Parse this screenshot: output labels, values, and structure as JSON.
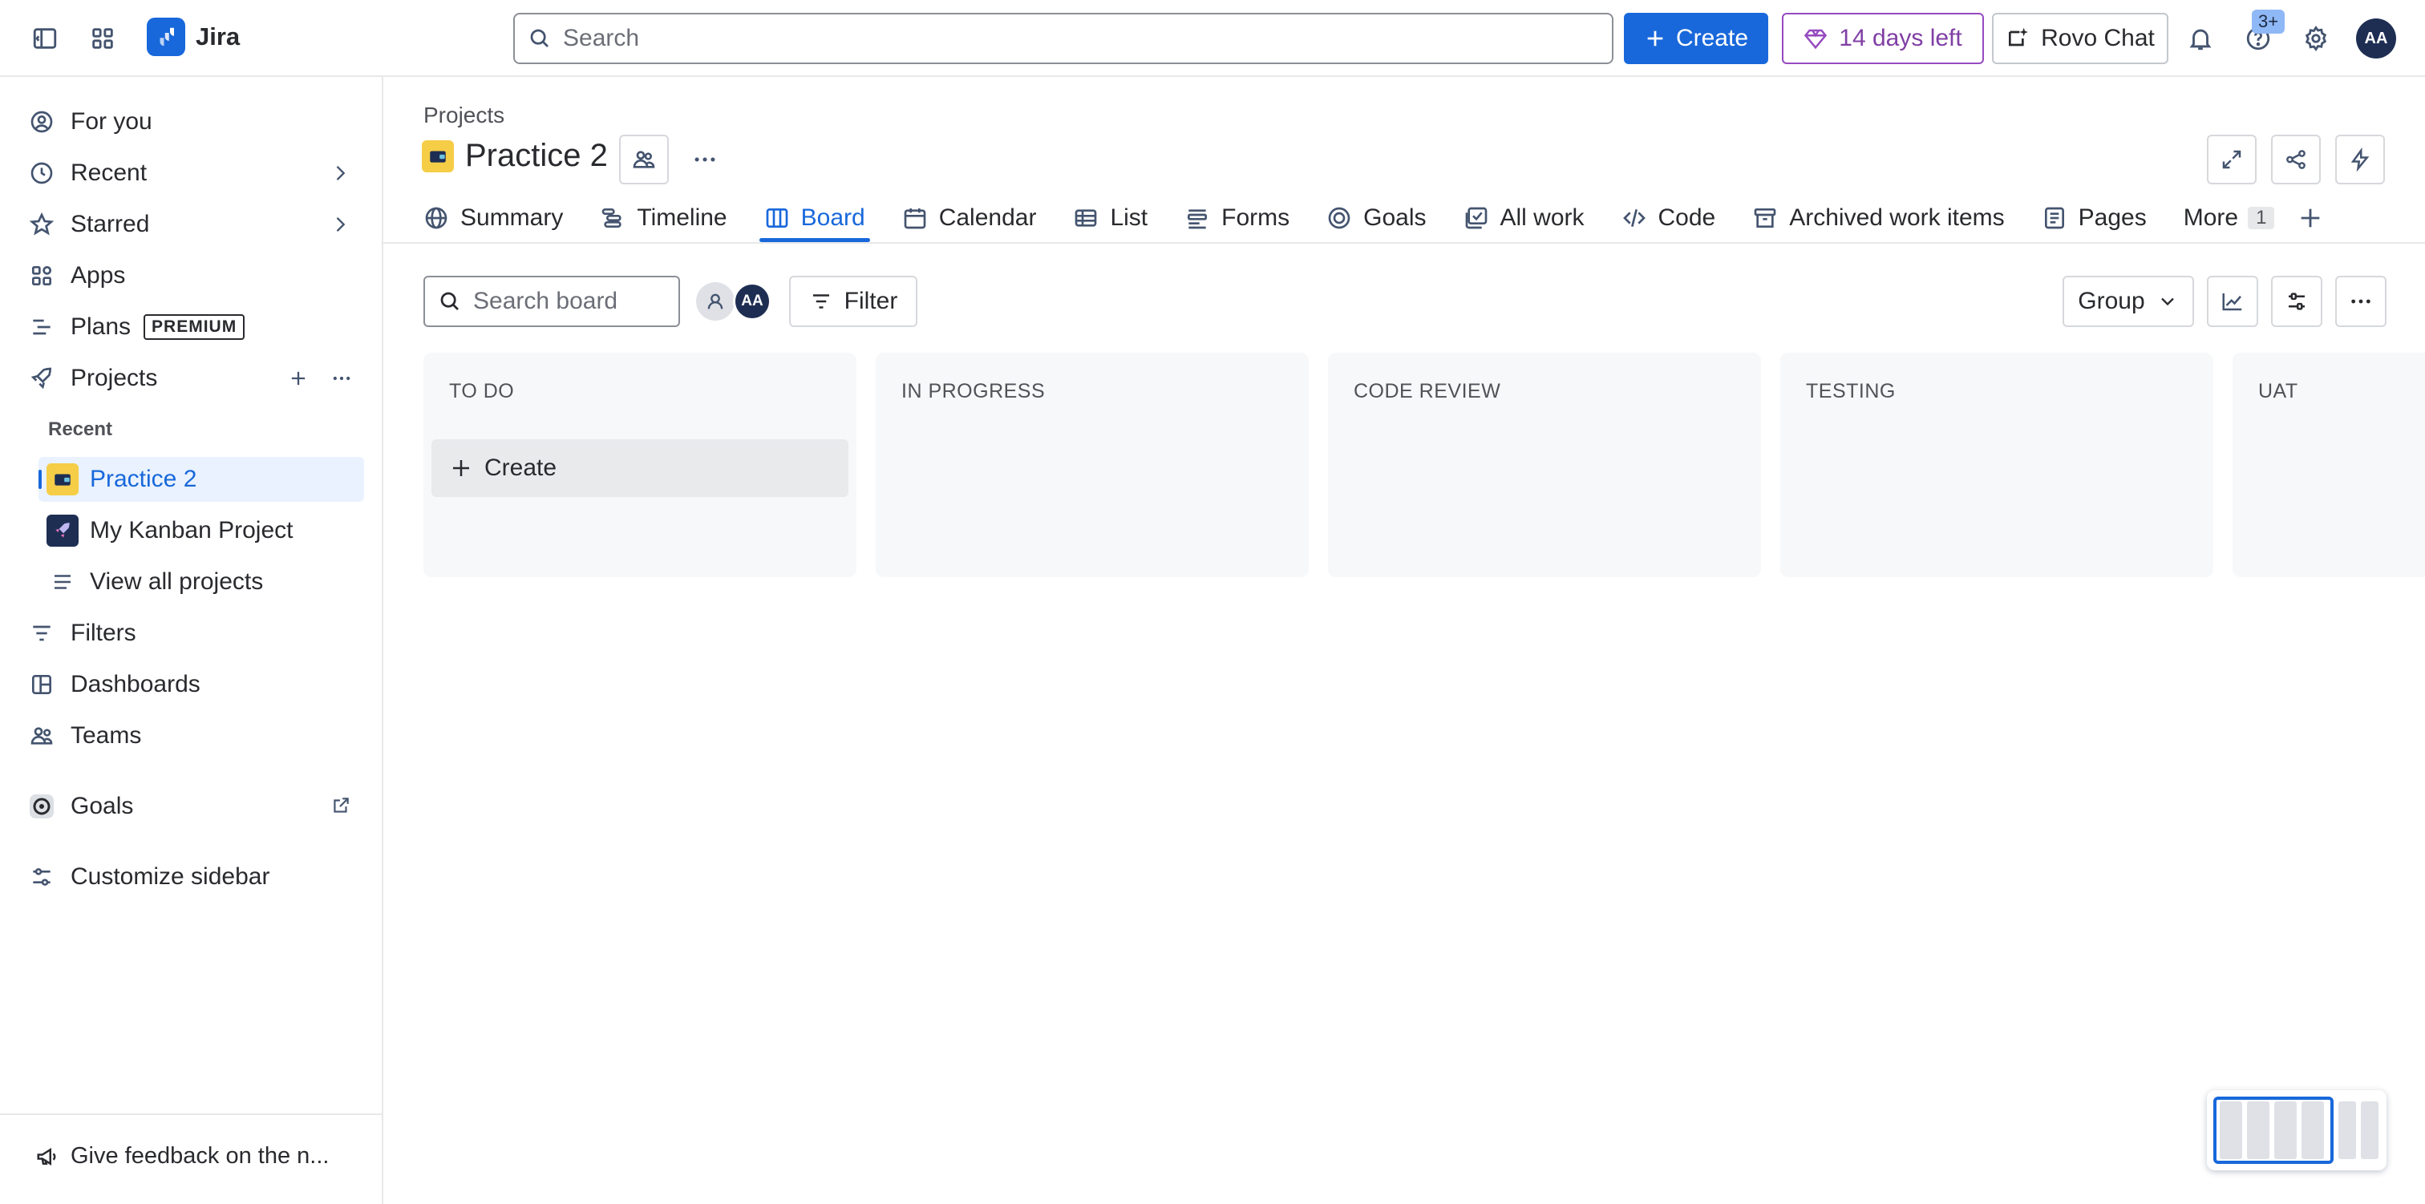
{
  "app": {
    "name": "Jira",
    "accent": "#1868db",
    "trial_color": "#964ac0"
  },
  "topbar": {
    "search_placeholder": "Search",
    "create_label": "Create",
    "trial_label": "14 days left",
    "rovo_label": "Rovo Chat",
    "help_badge": "3+",
    "avatar_initials": "AA"
  },
  "sidebar": {
    "items": [
      {
        "label": "For you",
        "icon": "user-circle-icon"
      },
      {
        "label": "Recent",
        "icon": "clock-icon"
      },
      {
        "label": "Starred",
        "icon": "star-icon"
      },
      {
        "label": "Apps",
        "icon": "apps-icon"
      },
      {
        "label": "Plans",
        "icon": "plans-icon",
        "badge": "PREMIUM"
      },
      {
        "label": "Projects",
        "icon": "rocket-icon"
      }
    ],
    "recent_section": "Recent",
    "projects": [
      {
        "label": "Practice 2",
        "active": true
      },
      {
        "label": "My Kanban Project"
      },
      {
        "label": "View all projects"
      }
    ],
    "lower": [
      {
        "label": "Filters",
        "icon": "filter-icon"
      },
      {
        "label": "Dashboards",
        "icon": "dashboard-icon"
      },
      {
        "label": "Teams",
        "icon": "teams-icon"
      },
      {
        "label": "Goals",
        "icon": "goals-icon"
      },
      {
        "label": "Customize sidebar",
        "icon": "customize-icon"
      }
    ],
    "feedback": "Give feedback on the n..."
  },
  "main": {
    "breadcrumb": "Projects",
    "title": "Practice 2",
    "tabs": [
      {
        "label": "Summary",
        "icon": "globe-icon"
      },
      {
        "label": "Timeline",
        "icon": "timeline-icon"
      },
      {
        "label": "Board",
        "icon": "board-icon",
        "active": true
      },
      {
        "label": "Calendar",
        "icon": "calendar-icon"
      },
      {
        "label": "List",
        "icon": "list-icon"
      },
      {
        "label": "Forms",
        "icon": "forms-icon"
      },
      {
        "label": "Goals",
        "icon": "goals-icon"
      },
      {
        "label": "All work",
        "icon": "all-work-icon"
      },
      {
        "label": "Code",
        "icon": "code-icon"
      },
      {
        "label": "Archived work items",
        "icon": "archive-icon"
      },
      {
        "label": "Pages",
        "icon": "pages-icon"
      },
      {
        "label": "More",
        "icon": "",
        "count": "1"
      }
    ],
    "board_search_placeholder": "Search board",
    "filter_label": "Filter",
    "group_label": "Group",
    "assignee_initials": "AA",
    "columns": [
      {
        "title": "TO DO",
        "create_label": "Create"
      },
      {
        "title": "IN PROGRESS"
      },
      {
        "title": "CODE REVIEW"
      },
      {
        "title": "TESTING"
      },
      {
        "title": "UAT"
      }
    ]
  }
}
